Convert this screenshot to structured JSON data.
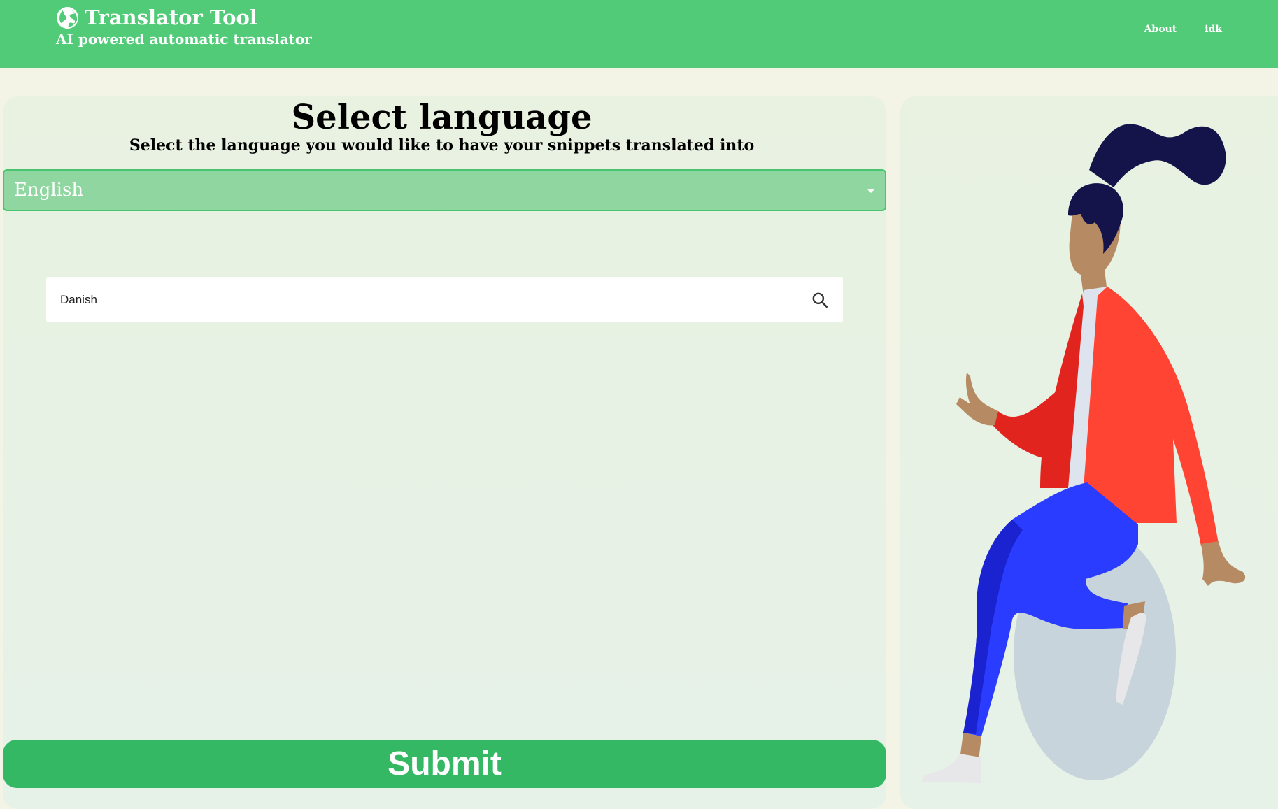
{
  "header": {
    "title": "Translator Tool",
    "subtitle": "AI powered automatic translator",
    "nav": [
      {
        "label": "About"
      },
      {
        "label": "idk"
      }
    ]
  },
  "main": {
    "title": "Select language",
    "subtitle": "Select the language you would like to have your snippets translated into",
    "select": {
      "value": "English"
    },
    "search": {
      "value": "Danish"
    },
    "submit_label": "Submit"
  },
  "colors": {
    "header": "#52cb79",
    "select_bg": "#8fd6a1",
    "submit_bg": "#34b864"
  },
  "icons": [
    "globe-icon",
    "chevron-down-icon",
    "search-icon"
  ]
}
